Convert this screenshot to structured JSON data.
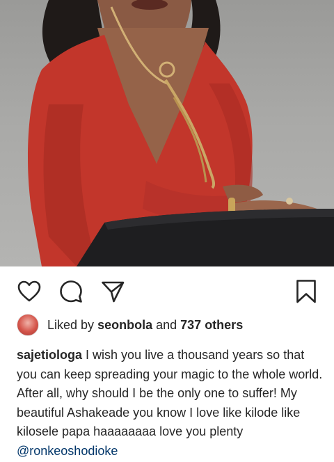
{
  "post": {
    "image_alt": "Woman in red dress with gold necklace posing at a dark table",
    "actions": {
      "like_icon": "heart-icon",
      "comment_icon": "comment-icon",
      "share_icon": "share-icon",
      "save_icon": "bookmark-icon"
    },
    "likes": {
      "prefix": "Liked by",
      "user": "seonbola",
      "joiner": "and",
      "others": "737 others"
    },
    "caption": {
      "username": "sajetiologa",
      "text": "I wish you live a thousand years so that you can keep spreading your magic to the whole world. After all, why should I be the only one to suffer! My beautiful Ashakeade you know I love like kilode like kilosele papa haaaaaaaa love you plenty",
      "mention": "@ronkeoshodioke"
    }
  },
  "colors": {
    "dress": "#c2362b",
    "table": "#1e1e20",
    "background": "#a8a8a6",
    "mention": "#003569",
    "text": "#262626"
  }
}
